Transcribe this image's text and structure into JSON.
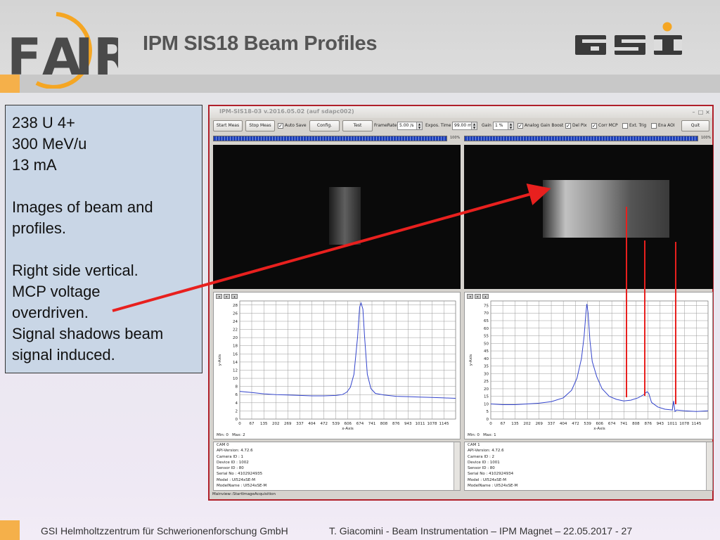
{
  "slide": {
    "title": "IPM SIS18 Beam Profiles",
    "info_lines": [
      "238 U 4+",
      "300 MeV/u",
      "13 mA",
      "",
      "Images of beam and",
      "profiles.",
      "",
      "Right side vertical.",
      "MCP voltage",
      "overdriven.",
      "Signal shadows beam",
      "signal induced."
    ],
    "footer_left": "GSI Helmholtzzentrum für Schwerionenforschung GmbH",
    "footer_right": "T. Giacomini - Beam Instrumentation – IPM Magnet – 22.05.2017 - ",
    "page_number": "27",
    "logos": {
      "left": "FAIR",
      "right": "GSI"
    },
    "colors": {
      "accent_orange": "#f5a623",
      "arrow_red": "#e8201e",
      "box_blue": "#c9d6e6"
    }
  },
  "app": {
    "title": "IPM-SIS18-03 v.2016.05.02 (auf sdapc002)",
    "window_controls": [
      "–",
      "□",
      "×"
    ],
    "toolbar": {
      "start_meas": "Start Meas",
      "stop_meas": "Stop Meas",
      "auto_save": "Auto Save",
      "auto_save_checked": true,
      "config": "Config.",
      "test": "Test",
      "framerate_label": "FrameRate",
      "framerate_value": "5.00 /s",
      "expos_label": "Expos. Time",
      "expos_value": "99.00 ms",
      "gain_label": "Gain",
      "gain_value": "1 %",
      "analog_gain_boost": "Analog Gain Boost",
      "analog_gain_boost_checked": true,
      "del_pix": "Del Pix",
      "del_pix_checked": true,
      "corr_mcp": "Corr MCP",
      "corr_mcp_checked": true,
      "ext_trig": "Ext. Trig",
      "ext_trig_checked": false,
      "ena_aoi": "Ena AOI",
      "ena_aoi_checked": false,
      "quit": "Quit"
    },
    "progress": [
      {
        "value": 1.0,
        "label": "100%"
      },
      {
        "value": 1.0,
        "label": "100%"
      }
    ],
    "status": "Mainview::StartImageAcquisition"
  },
  "chart_data": [
    {
      "type": "line",
      "xlabel": "x-Axis",
      "ylabel": "y-Axis",
      "xticks": [
        0,
        67,
        135,
        202,
        269,
        337,
        404,
        472,
        539,
        606,
        674,
        741,
        808,
        876,
        943,
        1011,
        1078,
        1145
      ],
      "yticks": [
        0,
        2,
        4,
        6,
        8,
        10,
        12,
        14,
        16,
        18,
        20,
        22,
        24,
        26,
        28
      ],
      "xlim": [
        0,
        1210
      ],
      "ylim": [
        0,
        29
      ],
      "limits": {
        "min_label": "Min",
        "min": "0",
        "max_label": "Max",
        "max": "2"
      },
      "grid": true,
      "series": [
        {
          "x": [
            0,
            67,
            135,
            202,
            269,
            337,
            404,
            472,
            539,
            575,
            600,
            620,
            640,
            660,
            672,
            680,
            690,
            700,
            715,
            735,
            760,
            808,
            876,
            943,
            1011,
            1078,
            1145,
            1210
          ],
          "y": [
            6.8,
            6.5,
            6.2,
            6.0,
            5.9,
            5.8,
            5.7,
            5.7,
            5.8,
            6.0,
            6.6,
            7.8,
            11,
            20,
            27.5,
            28.5,
            27,
            20,
            11,
            7.5,
            6.3,
            5.9,
            5.6,
            5.5,
            5.4,
            5.3,
            5.2,
            5.1
          ]
        }
      ]
    },
    {
      "type": "line",
      "xlabel": "x-Axis",
      "ylabel": "y-Axis",
      "xticks": [
        0,
        67,
        135,
        202,
        269,
        337,
        404,
        472,
        539,
        606,
        674,
        741,
        808,
        876,
        943,
        1011,
        1078,
        1145
      ],
      "yticks": [
        0,
        5,
        10,
        15,
        20,
        25,
        30,
        35,
        40,
        45,
        50,
        55,
        60,
        65,
        70,
        75
      ],
      "xlim": [
        0,
        1210
      ],
      "ylim": [
        0,
        78
      ],
      "limits": {
        "min_label": "Min",
        "min": "0",
        "max_label": "Max",
        "max": "1"
      },
      "grid": true,
      "series": [
        {
          "x": [
            0,
            67,
            135,
            202,
            269,
            337,
            404,
            450,
            480,
            505,
            520,
            530,
            535,
            542,
            552,
            565,
            590,
            620,
            660,
            700,
            741,
            780,
            820,
            850,
            870,
            880,
            895,
            930,
            970,
            1011,
            1018,
            1026,
            1035,
            1078,
            1145,
            1210
          ],
          "y": [
            10,
            9.5,
            9.5,
            10,
            10.5,
            11.5,
            14,
            19,
            27,
            40,
            55,
            70,
            76,
            70,
            52,
            38,
            28,
            20,
            15,
            13,
            12,
            12.5,
            14,
            16,
            18,
            17,
            11,
            8,
            6.5,
            6,
            12,
            5,
            6,
            5.5,
            5,
            5.5
          ]
        }
      ]
    }
  ],
  "cameras": [
    {
      "lines": [
        "CAM 0",
        "API-Version: 4.72.6",
        "Camera ID      : 1",
        "Device ID        : 1002",
        "Sensor ID        : 80",
        "Serial No        : 4102924935",
        "Model             : UI524xSE-M",
        "ModelName     : UI524xSE-M"
      ]
    },
    {
      "lines": [
        "CAM 1",
        "API-Version: 4.72.6",
        "Camera ID      : 2",
        "Device ID        : 1001",
        "Sensor ID        : 80",
        "Serial No        : 4102924934",
        "Model             : UI524xSE-M",
        "ModelName     : UI524xSE-M"
      ]
    }
  ]
}
